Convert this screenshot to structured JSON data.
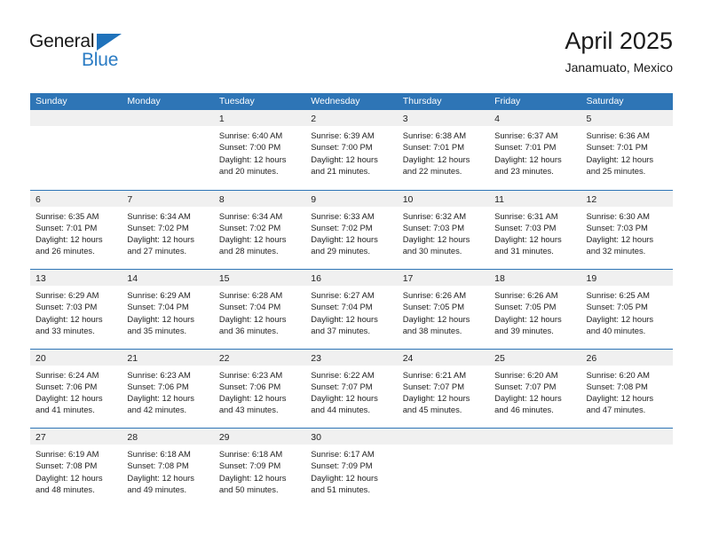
{
  "brand": {
    "name_part1": "General",
    "name_part2": "Blue",
    "accent_color": "#2b7cc4",
    "triangle_color": "#1f72bb"
  },
  "header": {
    "title": "April 2025",
    "subtitle": "Janamuato, Mexico",
    "header_bg": "#2e75b6",
    "daynum_bg": "#f0f0f0"
  },
  "day_names": [
    "Sunday",
    "Monday",
    "Tuesday",
    "Wednesday",
    "Thursday",
    "Friday",
    "Saturday"
  ],
  "weeks": [
    [
      {
        "day": "",
        "lines": []
      },
      {
        "day": "",
        "lines": []
      },
      {
        "day": "1",
        "lines": [
          "Sunrise: 6:40 AM",
          "Sunset: 7:00 PM",
          "Daylight: 12 hours",
          "and 20 minutes."
        ]
      },
      {
        "day": "2",
        "lines": [
          "Sunrise: 6:39 AM",
          "Sunset: 7:00 PM",
          "Daylight: 12 hours",
          "and 21 minutes."
        ]
      },
      {
        "day": "3",
        "lines": [
          "Sunrise: 6:38 AM",
          "Sunset: 7:01 PM",
          "Daylight: 12 hours",
          "and 22 minutes."
        ]
      },
      {
        "day": "4",
        "lines": [
          "Sunrise: 6:37 AM",
          "Sunset: 7:01 PM",
          "Daylight: 12 hours",
          "and 23 minutes."
        ]
      },
      {
        "day": "5",
        "lines": [
          "Sunrise: 6:36 AM",
          "Sunset: 7:01 PM",
          "Daylight: 12 hours",
          "and 25 minutes."
        ]
      }
    ],
    [
      {
        "day": "6",
        "lines": [
          "Sunrise: 6:35 AM",
          "Sunset: 7:01 PM",
          "Daylight: 12 hours",
          "and 26 minutes."
        ]
      },
      {
        "day": "7",
        "lines": [
          "Sunrise: 6:34 AM",
          "Sunset: 7:02 PM",
          "Daylight: 12 hours",
          "and 27 minutes."
        ]
      },
      {
        "day": "8",
        "lines": [
          "Sunrise: 6:34 AM",
          "Sunset: 7:02 PM",
          "Daylight: 12 hours",
          "and 28 minutes."
        ]
      },
      {
        "day": "9",
        "lines": [
          "Sunrise: 6:33 AM",
          "Sunset: 7:02 PM",
          "Daylight: 12 hours",
          "and 29 minutes."
        ]
      },
      {
        "day": "10",
        "lines": [
          "Sunrise: 6:32 AM",
          "Sunset: 7:03 PM",
          "Daylight: 12 hours",
          "and 30 minutes."
        ]
      },
      {
        "day": "11",
        "lines": [
          "Sunrise: 6:31 AM",
          "Sunset: 7:03 PM",
          "Daylight: 12 hours",
          "and 31 minutes."
        ]
      },
      {
        "day": "12",
        "lines": [
          "Sunrise: 6:30 AM",
          "Sunset: 7:03 PM",
          "Daylight: 12 hours",
          "and 32 minutes."
        ]
      }
    ],
    [
      {
        "day": "13",
        "lines": [
          "Sunrise: 6:29 AM",
          "Sunset: 7:03 PM",
          "Daylight: 12 hours",
          "and 33 minutes."
        ]
      },
      {
        "day": "14",
        "lines": [
          "Sunrise: 6:29 AM",
          "Sunset: 7:04 PM",
          "Daylight: 12 hours",
          "and 35 minutes."
        ]
      },
      {
        "day": "15",
        "lines": [
          "Sunrise: 6:28 AM",
          "Sunset: 7:04 PM",
          "Daylight: 12 hours",
          "and 36 minutes."
        ]
      },
      {
        "day": "16",
        "lines": [
          "Sunrise: 6:27 AM",
          "Sunset: 7:04 PM",
          "Daylight: 12 hours",
          "and 37 minutes."
        ]
      },
      {
        "day": "17",
        "lines": [
          "Sunrise: 6:26 AM",
          "Sunset: 7:05 PM",
          "Daylight: 12 hours",
          "and 38 minutes."
        ]
      },
      {
        "day": "18",
        "lines": [
          "Sunrise: 6:26 AM",
          "Sunset: 7:05 PM",
          "Daylight: 12 hours",
          "and 39 minutes."
        ]
      },
      {
        "day": "19",
        "lines": [
          "Sunrise: 6:25 AM",
          "Sunset: 7:05 PM",
          "Daylight: 12 hours",
          "and 40 minutes."
        ]
      }
    ],
    [
      {
        "day": "20",
        "lines": [
          "Sunrise: 6:24 AM",
          "Sunset: 7:06 PM",
          "Daylight: 12 hours",
          "and 41 minutes."
        ]
      },
      {
        "day": "21",
        "lines": [
          "Sunrise: 6:23 AM",
          "Sunset: 7:06 PM",
          "Daylight: 12 hours",
          "and 42 minutes."
        ]
      },
      {
        "day": "22",
        "lines": [
          "Sunrise: 6:23 AM",
          "Sunset: 7:06 PM",
          "Daylight: 12 hours",
          "and 43 minutes."
        ]
      },
      {
        "day": "23",
        "lines": [
          "Sunrise: 6:22 AM",
          "Sunset: 7:07 PM",
          "Daylight: 12 hours",
          "and 44 minutes."
        ]
      },
      {
        "day": "24",
        "lines": [
          "Sunrise: 6:21 AM",
          "Sunset: 7:07 PM",
          "Daylight: 12 hours",
          "and 45 minutes."
        ]
      },
      {
        "day": "25",
        "lines": [
          "Sunrise: 6:20 AM",
          "Sunset: 7:07 PM",
          "Daylight: 12 hours",
          "and 46 minutes."
        ]
      },
      {
        "day": "26",
        "lines": [
          "Sunrise: 6:20 AM",
          "Sunset: 7:08 PM",
          "Daylight: 12 hours",
          "and 47 minutes."
        ]
      }
    ],
    [
      {
        "day": "27",
        "lines": [
          "Sunrise: 6:19 AM",
          "Sunset: 7:08 PM",
          "Daylight: 12 hours",
          "and 48 minutes."
        ]
      },
      {
        "day": "28",
        "lines": [
          "Sunrise: 6:18 AM",
          "Sunset: 7:08 PM",
          "Daylight: 12 hours",
          "and 49 minutes."
        ]
      },
      {
        "day": "29",
        "lines": [
          "Sunrise: 6:18 AM",
          "Sunset: 7:09 PM",
          "Daylight: 12 hours",
          "and 50 minutes."
        ]
      },
      {
        "day": "30",
        "lines": [
          "Sunrise: 6:17 AM",
          "Sunset: 7:09 PM",
          "Daylight: 12 hours",
          "and 51 minutes."
        ]
      },
      {
        "day": "",
        "lines": []
      },
      {
        "day": "",
        "lines": []
      },
      {
        "day": "",
        "lines": []
      }
    ]
  ]
}
